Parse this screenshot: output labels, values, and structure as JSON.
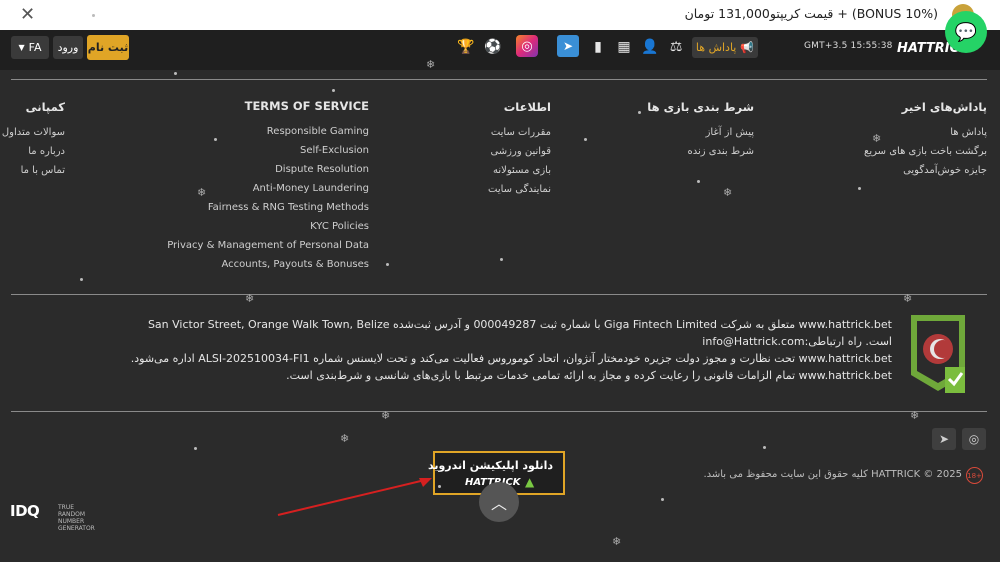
{
  "promo": {
    "text": "(BONUS 10%) + قیمت کریپتو131,000 تومان"
  },
  "header": {
    "lang": "FA",
    "login": "ورود",
    "signup": "ثبت نام",
    "rewards": "پاداش ها",
    "time": "GMT+3.5   15:55:38",
    "logo": "HATTRICK"
  },
  "columns": {
    "rewards": {
      "title": "پاداش‌های اخیر",
      "items": [
        "پاداش ها",
        "برگشت باخت بازی های سریع",
        "جایزه خوش‌آمدگویی"
      ]
    },
    "betting": {
      "title": "شرط بندی بازی ها",
      "items": [
        "پیش از آغاز",
        "شرط بندی زنده"
      ]
    },
    "info": {
      "title": "اطلاعات",
      "items": [
        "مقررات سایت",
        "قوانین ورزشی",
        "بازی مسئولانه",
        "نمایندگی سایت"
      ]
    },
    "terms": {
      "title": "TERMS OF SERVICE",
      "items": [
        "Responsible Gaming",
        "Self-Exclusion",
        "Dispute Resolution",
        "Anti-Money Laundering",
        "Fairness & RNG Testing Methods",
        "KYC Policies",
        "Privacy & Management of Personal Data",
        "Accounts, Payouts & Bonuses"
      ]
    },
    "company": {
      "title": "کمپانی",
      "items": [
        "سوالات متداول",
        "درباره ما",
        "تماس با ما"
      ]
    }
  },
  "license": {
    "lines": [
      "www.hattrick.bet متعلق به شرکت Giga Fintech Limited با شماره ثبت 000049287 و آدرس ثبت‌شده San Victor Street, Orange Walk Town, Belize",
      "است. راه ارتباطی:info@Hattrick.com",
      "www.hattrick.bet تحت نظارت و مجوز دولت جزیره خودمختار آنژوان، اتحاد کوموروس فعالیت می‌کند و تحت لایسنس شماره ALSI-202510034-FI1 اداره می‌شود.",
      "www.hattrick.bet تمام الزامات قانونی را رعایت کرده و مجاز به ارائه تمامی خدمات مرتبط با بازی‌های شانسی و شرط‌بندی است."
    ]
  },
  "footer": {
    "copyright": "HATTRICK © 2025 کلیه حقوق این سایت محفوظ می باشد.",
    "age": "18+",
    "android_title": "دانلود اپلیکیشن اندروید",
    "android_logo": "HATTRICK",
    "idq_brand": "IDQ",
    "idq_sub1": "TRUE RANDOM",
    "idq_sub2": "NUMBER GENERATOR"
  },
  "colors": {
    "accent": "#e0a526",
    "background": "#2b2b2b",
    "header": "#1f1f1f",
    "telegram": "#3a8fd6",
    "chat": "#25d366"
  },
  "icons": [
    "close-icon",
    "trophy-icon",
    "soccer-ball-icon",
    "instagram-icon",
    "telegram-icon",
    "bar-chart-icon",
    "scoreboard-icon",
    "user-icon",
    "gavel-icon",
    "megaphone-icon",
    "chat-bubble-icon",
    "chevron-up-icon",
    "android-icon"
  ]
}
